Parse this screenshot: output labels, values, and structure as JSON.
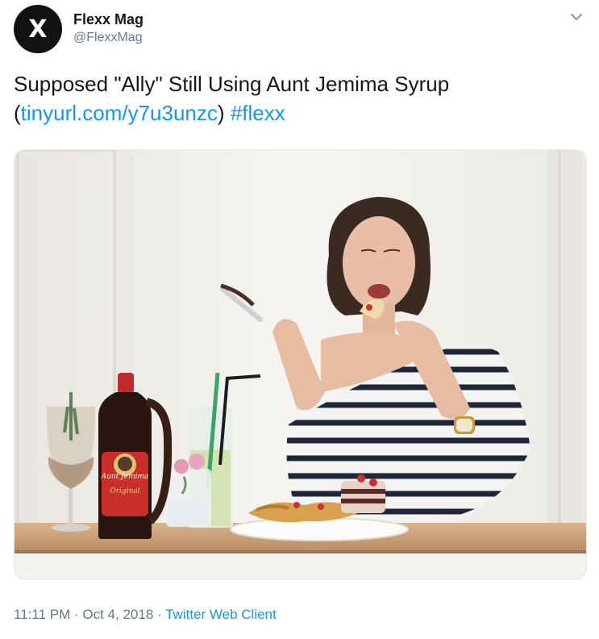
{
  "tweet": {
    "avatar_letter": "X",
    "display_name": "Flexx Mag",
    "handle": "@FlexxMag",
    "text_main": "Supposed \"Ally\" Still Using Aunt Jemima Syrup",
    "paren_open": "(",
    "url": "tinyurl.com/y7u3unzc",
    "paren_close": ")",
    "hashtag": "#flexx",
    "time": "11:11 PM",
    "date": "Oct 4, 2018",
    "dot": "·",
    "client": "Twitter Web Client"
  },
  "photo": {
    "bottle_label_brand": "Aunt Jemima",
    "bottle_label_variant": "Original"
  },
  "colors": {
    "link": "#1b95e0",
    "secondary_text": "#657786",
    "avatar_bg": "#121212"
  }
}
